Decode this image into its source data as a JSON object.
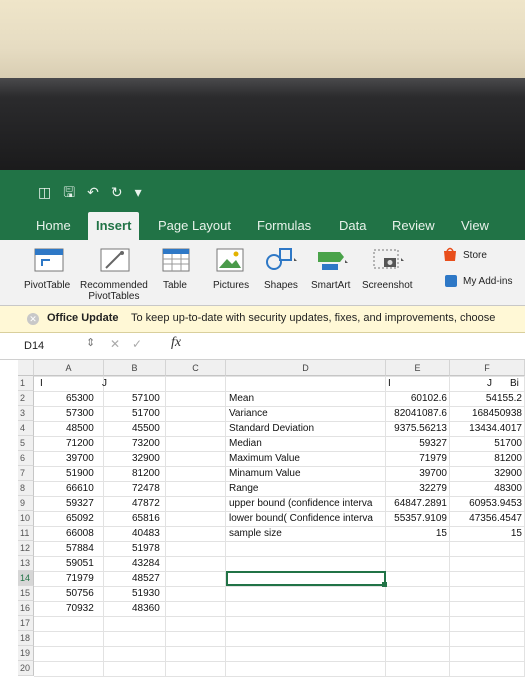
{
  "ribbon_tabs": [
    "Home",
    "Insert",
    "Page Layout",
    "Formulas",
    "Data",
    "Review",
    "View"
  ],
  "active_tab": "Insert",
  "ribbon_buttons": {
    "pivot_table": "PivotTable",
    "recommended_line1": "Recommended",
    "recommended_line2": "PivotTables",
    "table": "Table",
    "pictures": "Pictures",
    "shapes": "Shapes",
    "smartart": "SmartArt",
    "screenshot": "Screenshot",
    "store": "Store",
    "my_addins": "My Add-ins"
  },
  "message_bar": {
    "title": "Office Update",
    "text": "To keep up-to-date with security updates, fixes, and improvements, choose"
  },
  "formula_bar": {
    "name_box": "D14",
    "fx": "fx"
  },
  "columns": [
    "A",
    "B",
    "C",
    "D",
    "E",
    "F"
  ],
  "row1": {
    "a": "I",
    "b": "J",
    "e": "I",
    "f": "J",
    "g": "Bi"
  },
  "rows": [
    {
      "num": "1"
    },
    {
      "num": "2",
      "a": "65300",
      "b": "57100",
      "d": "Mean",
      "e": "60102.6",
      "f": "54155.2"
    },
    {
      "num": "3",
      "a": "57300",
      "b": "51700",
      "d": "Variance",
      "e": "82041087.6",
      "f": "168450938"
    },
    {
      "num": "4",
      "a": "48500",
      "b": "45500",
      "d": "Standard Deviation",
      "e": "9375.56213",
      "f": "13434.4017"
    },
    {
      "num": "5",
      "a": "71200",
      "b": "73200",
      "d": "Median",
      "e": "59327",
      "f": "51700"
    },
    {
      "num": "6",
      "a": "39700",
      "b": "32900",
      "d": "Maximum Value",
      "e": "71979",
      "f": "81200"
    },
    {
      "num": "7",
      "a": "51900",
      "b": "81200",
      "d": "Minamum Value",
      "e": "39700",
      "f": "32900"
    },
    {
      "num": "8",
      "a": "66610",
      "b": "72478",
      "d": "Range",
      "e": "32279",
      "f": "48300"
    },
    {
      "num": "9",
      "a": "59327",
      "b": "47872",
      "d": "upper bound (confidence interva",
      "e": "64847.2891",
      "f": "60953.9453"
    },
    {
      "num": "10",
      "a": "65092",
      "b": "65816",
      "d": "lower bound( Confidence interva",
      "e": "55357.9109",
      "f": "47356.4547"
    },
    {
      "num": "11",
      "a": "66008",
      "b": "40483",
      "d": "sample size",
      "e": "15",
      "f": "15"
    },
    {
      "num": "12",
      "a": "57884",
      "b": "51978"
    },
    {
      "num": "13",
      "a": "59051",
      "b": "43284"
    },
    {
      "num": "14",
      "a": "71979",
      "b": "48527"
    },
    {
      "num": "15",
      "a": "50756",
      "b": "51930"
    },
    {
      "num": "16",
      "a": "70932",
      "b": "48360"
    },
    {
      "num": "17"
    },
    {
      "num": "18"
    },
    {
      "num": "19"
    },
    {
      "num": "20"
    }
  ],
  "accent_color": "#217346"
}
